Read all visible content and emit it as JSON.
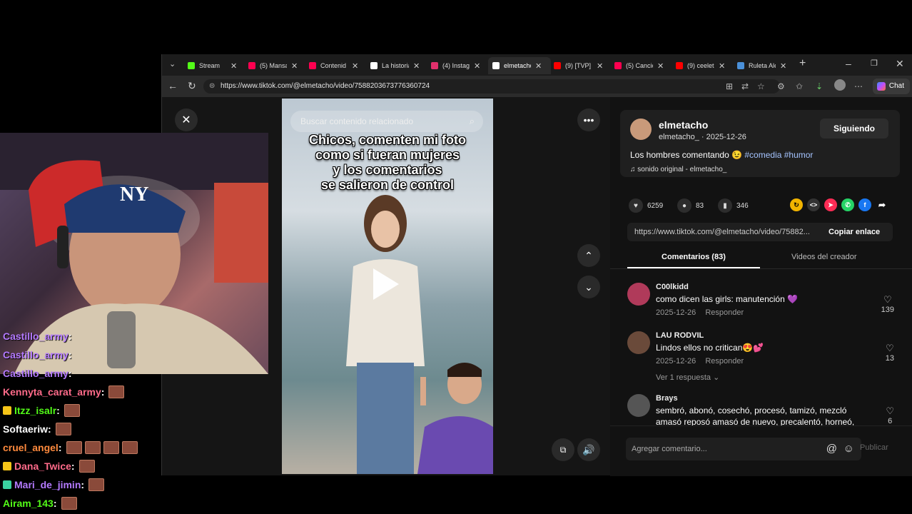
{
  "tabs": [
    {
      "title": "Stream",
      "color": "#53fc18"
    },
    {
      "title": "(5) Mansa",
      "color": "#ff0050"
    },
    {
      "title": "Contenid",
      "color": "#ff0050"
    },
    {
      "title": "La historia",
      "color": "#ffffff"
    },
    {
      "title": "(4) Instagr",
      "color": "#e1306c"
    },
    {
      "title": "elmetacho",
      "color": "#ffffff",
      "active": true
    },
    {
      "title": "(9) [TVP]",
      "color": "#ff0000"
    },
    {
      "title": "(5) Cancio",
      "color": "#ff0050"
    },
    {
      "title": "(9) ceelet",
      "color": "#ff0000"
    },
    {
      "title": "Ruleta Ale",
      "color": "#4a90d9"
    }
  ],
  "address": {
    "url": "https://www.tiktok.com/@elmetacho/video/7588203673776360724"
  },
  "toolbar": {
    "chat_label": "Chat"
  },
  "video": {
    "search_placeholder": "Buscar contenido relacionado",
    "caption_lines": [
      "Chicos, comenten mi foto",
      "como si fueran mujeres",
      "y los comentarios",
      "se salieron de control"
    ]
  },
  "creator": {
    "username": "elmetacho",
    "handle_date": "elmetacho_ · 2025-12-26",
    "follow_label": "Siguiendo",
    "description": "Los hombres comentando",
    "hashtags": "#comedia #humor",
    "sound": "sonido original - elmetacho_"
  },
  "stats": {
    "likes": "6259",
    "comments": "83",
    "saves": "346"
  },
  "link": {
    "url": "https://www.tiktok.com/@elmetacho/video/75882...",
    "copy_label": "Copiar enlace"
  },
  "comment_tabs": {
    "comments": "Comentarios (83)",
    "creator_videos": "Videos del creador"
  },
  "comments": [
    {
      "user": "C00lkidd",
      "text": "como dicen las girls: manutención 💜",
      "date": "2025-12-26",
      "reply": "Responder",
      "likes": "139"
    },
    {
      "user": "LAU RODVIL",
      "text": "Lindos ellos no critican😍💕",
      "date": "2025-12-26",
      "reply": "Responder",
      "likes": "13",
      "replies": "Ver 1 respuesta"
    },
    {
      "user": "Brays",
      "text": "sembró, abonó, cosechó, procesó, tamizó, mezcló",
      "text2": "amasó reposó amasó de nuevo, precalentó, horneó,",
      "likes": "6"
    }
  ],
  "comment_input": {
    "placeholder": "Agregar comentario...",
    "post_label": "Publicar"
  },
  "chat": [
    {
      "user": "Castillo_army",
      "color": "#b47aff",
      "emotes": 0,
      "badge": ""
    },
    {
      "user": "Castillo_army",
      "color": "#b47aff",
      "emotes": 0,
      "badge": ""
    },
    {
      "user": "Castillo_army",
      "color": "#b47aff",
      "emotes": 0,
      "badge": ""
    },
    {
      "user": "Kennyta_carat_army",
      "color": "#ff6b8a",
      "emotes": 1,
      "badge": ""
    },
    {
      "user": "Itzz_isalr",
      "color": "#53fc18",
      "emotes": 1,
      "badge": "#f5c518"
    },
    {
      "user": "Softaeriw",
      "color": "#ffffff",
      "emotes": 1,
      "badge": ""
    },
    {
      "user": "cruel_angel",
      "color": "#ff8a3d",
      "emotes": 4,
      "badge": ""
    },
    {
      "user": "Dana_Twice",
      "color": "#ff6b8a",
      "emotes": 1,
      "badge": "#f5c518"
    },
    {
      "user": "Mari_de_jimin",
      "color": "#b47aff",
      "emotes": 1,
      "badge": "#3ad1a0"
    },
    {
      "user": "Airam_143",
      "color": "#53fc18",
      "emotes": 1,
      "badge": ""
    }
  ]
}
